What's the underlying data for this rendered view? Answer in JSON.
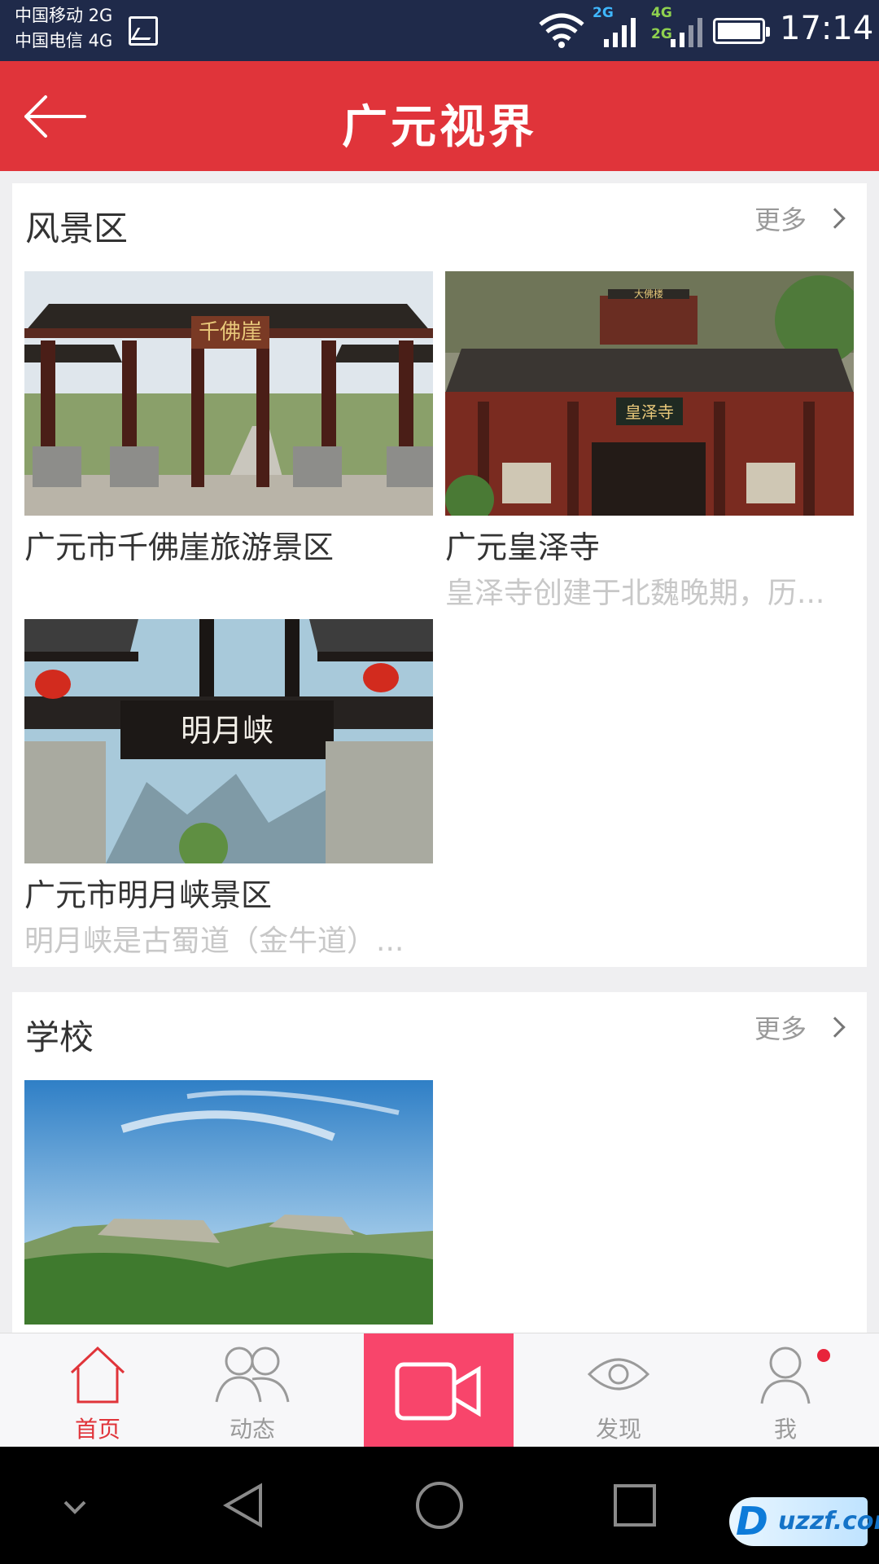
{
  "status_bar": {
    "carrier1": "中国移动 2G",
    "carrier2": "中国电信 4G",
    "net1_tag": "2G",
    "net2_tag_top": "4G",
    "net2_tag_bottom": "2G",
    "time": "17:14"
  },
  "header": {
    "title": "广元视界",
    "back_icon": "back-arrow-icon"
  },
  "sections": [
    {
      "title": "风景区",
      "more_label": "更多",
      "items": [
        {
          "caption": "广元市千佛崖旅游景区",
          "description": ""
        },
        {
          "caption": "广元皇泽寺",
          "description": "皇泽寺创建于北魏晚期，历..."
        },
        {
          "caption": "广元市明月峡景区",
          "description": "明月峡是古蜀道（金牛道）..."
        }
      ]
    },
    {
      "title": "学校",
      "more_label": "更多",
      "items": []
    }
  ],
  "images": {
    "gate1_sign": "千佛崖",
    "temple_sign": "皇泽寺",
    "temple_top_sign": "大佛楼",
    "gate3_sign": "明月峡"
  },
  "tab_bar": {
    "tabs": [
      {
        "label": "首页",
        "icon": "home-icon",
        "active": true
      },
      {
        "label": "动态",
        "icon": "people-icon",
        "active": false
      },
      {
        "label": "",
        "icon": "video-camera-icon",
        "active": false
      },
      {
        "label": "发现",
        "icon": "eye-icon",
        "active": false
      },
      {
        "label": "我",
        "icon": "user-icon",
        "active": false
      }
    ]
  },
  "watermark": {
    "text": "uzzf.com",
    "letter": "D"
  },
  "colors": {
    "accent": "#e0343a",
    "record": "#f8456b"
  }
}
